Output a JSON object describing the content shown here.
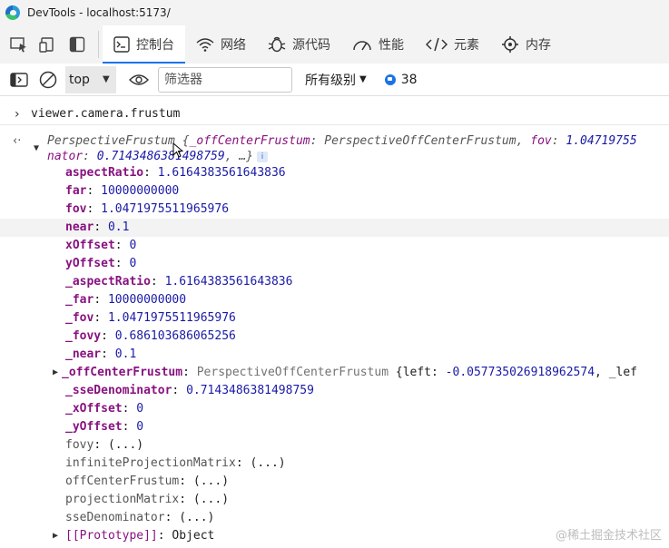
{
  "window": {
    "title": "DevTools - localhost:5173/"
  },
  "tabs": [
    {
      "label": "控制台",
      "icon": "console-icon",
      "active": true
    },
    {
      "label": "网络",
      "icon": "wifi-icon",
      "active": false
    },
    {
      "label": "源代码",
      "icon": "bug-icon",
      "active": false
    },
    {
      "label": "性能",
      "icon": "performance-icon",
      "active": false
    },
    {
      "label": "元素",
      "icon": "code-icon",
      "active": false
    },
    {
      "label": "内存",
      "icon": "memory-icon",
      "active": false
    }
  ],
  "toolbar": {
    "context": "top",
    "filter_placeholder": "筛选器",
    "levels": "所有级别",
    "message_count": "38"
  },
  "console": {
    "command": "viewer.camera.frustum",
    "summary_line1_class": "PerspectiveFrustum",
    "summary_line1_rest_a": " {",
    "summary_line1_key1": "_offCenterFrustum",
    "summary_line1_val1": "PerspectiveOffCenterFrustum",
    "summary_line1_key2": "fov",
    "summary_line1_val2": "1.04719755",
    "summary_line2_key": "nator",
    "summary_line2_val": "0.7143486381498759",
    "summary_line2_tail": ", …}",
    "properties": [
      {
        "key": "aspectRatio",
        "value": "1.6164383561643836",
        "kind": "own"
      },
      {
        "key": "far",
        "value": "10000000000",
        "kind": "own"
      },
      {
        "key": "fov",
        "value": "1.0471975511965976",
        "kind": "own"
      },
      {
        "key": "near",
        "value": "0.1",
        "kind": "own"
      },
      {
        "key": "xOffset",
        "value": "0",
        "kind": "own"
      },
      {
        "key": "yOffset",
        "value": "0",
        "kind": "own"
      },
      {
        "key": "_aspectRatio",
        "value": "1.6164383561643836",
        "kind": "own"
      },
      {
        "key": "_far",
        "value": "10000000000",
        "kind": "own"
      },
      {
        "key": "_fov",
        "value": "1.0471975511965976",
        "kind": "own"
      },
      {
        "key": "_fovy",
        "value": "0.686103686065256",
        "kind": "own"
      },
      {
        "key": "_near",
        "value": "0.1",
        "kind": "own"
      }
    ],
    "off_center": {
      "key": "_offCenterFrustum",
      "class": "PerspectiveOffCenterFrustum",
      "rest": " {left: ",
      "left_val": "-0.057735026918962574",
      "tail": ", _lef"
    },
    "properties2": [
      {
        "key": "_sseDenominator",
        "value": "0.7143486381498759"
      },
      {
        "key": "_xOffset",
        "value": "0"
      },
      {
        "key": "_yOffset",
        "value": "0"
      }
    ],
    "getters": [
      {
        "key": "fovy",
        "value": "(...)"
      },
      {
        "key": "infiniteProjectionMatrix",
        "value": "(...)"
      },
      {
        "key": "offCenterFrustum",
        "value": "(...)"
      },
      {
        "key": "projectionMatrix",
        "value": "(...)"
      },
      {
        "key": "sseDenominator",
        "value": "(...)"
      }
    ],
    "prototype": {
      "key": "[[Prototype]]",
      "value": "Object"
    }
  },
  "watermark": "@稀土掘金技术社区"
}
